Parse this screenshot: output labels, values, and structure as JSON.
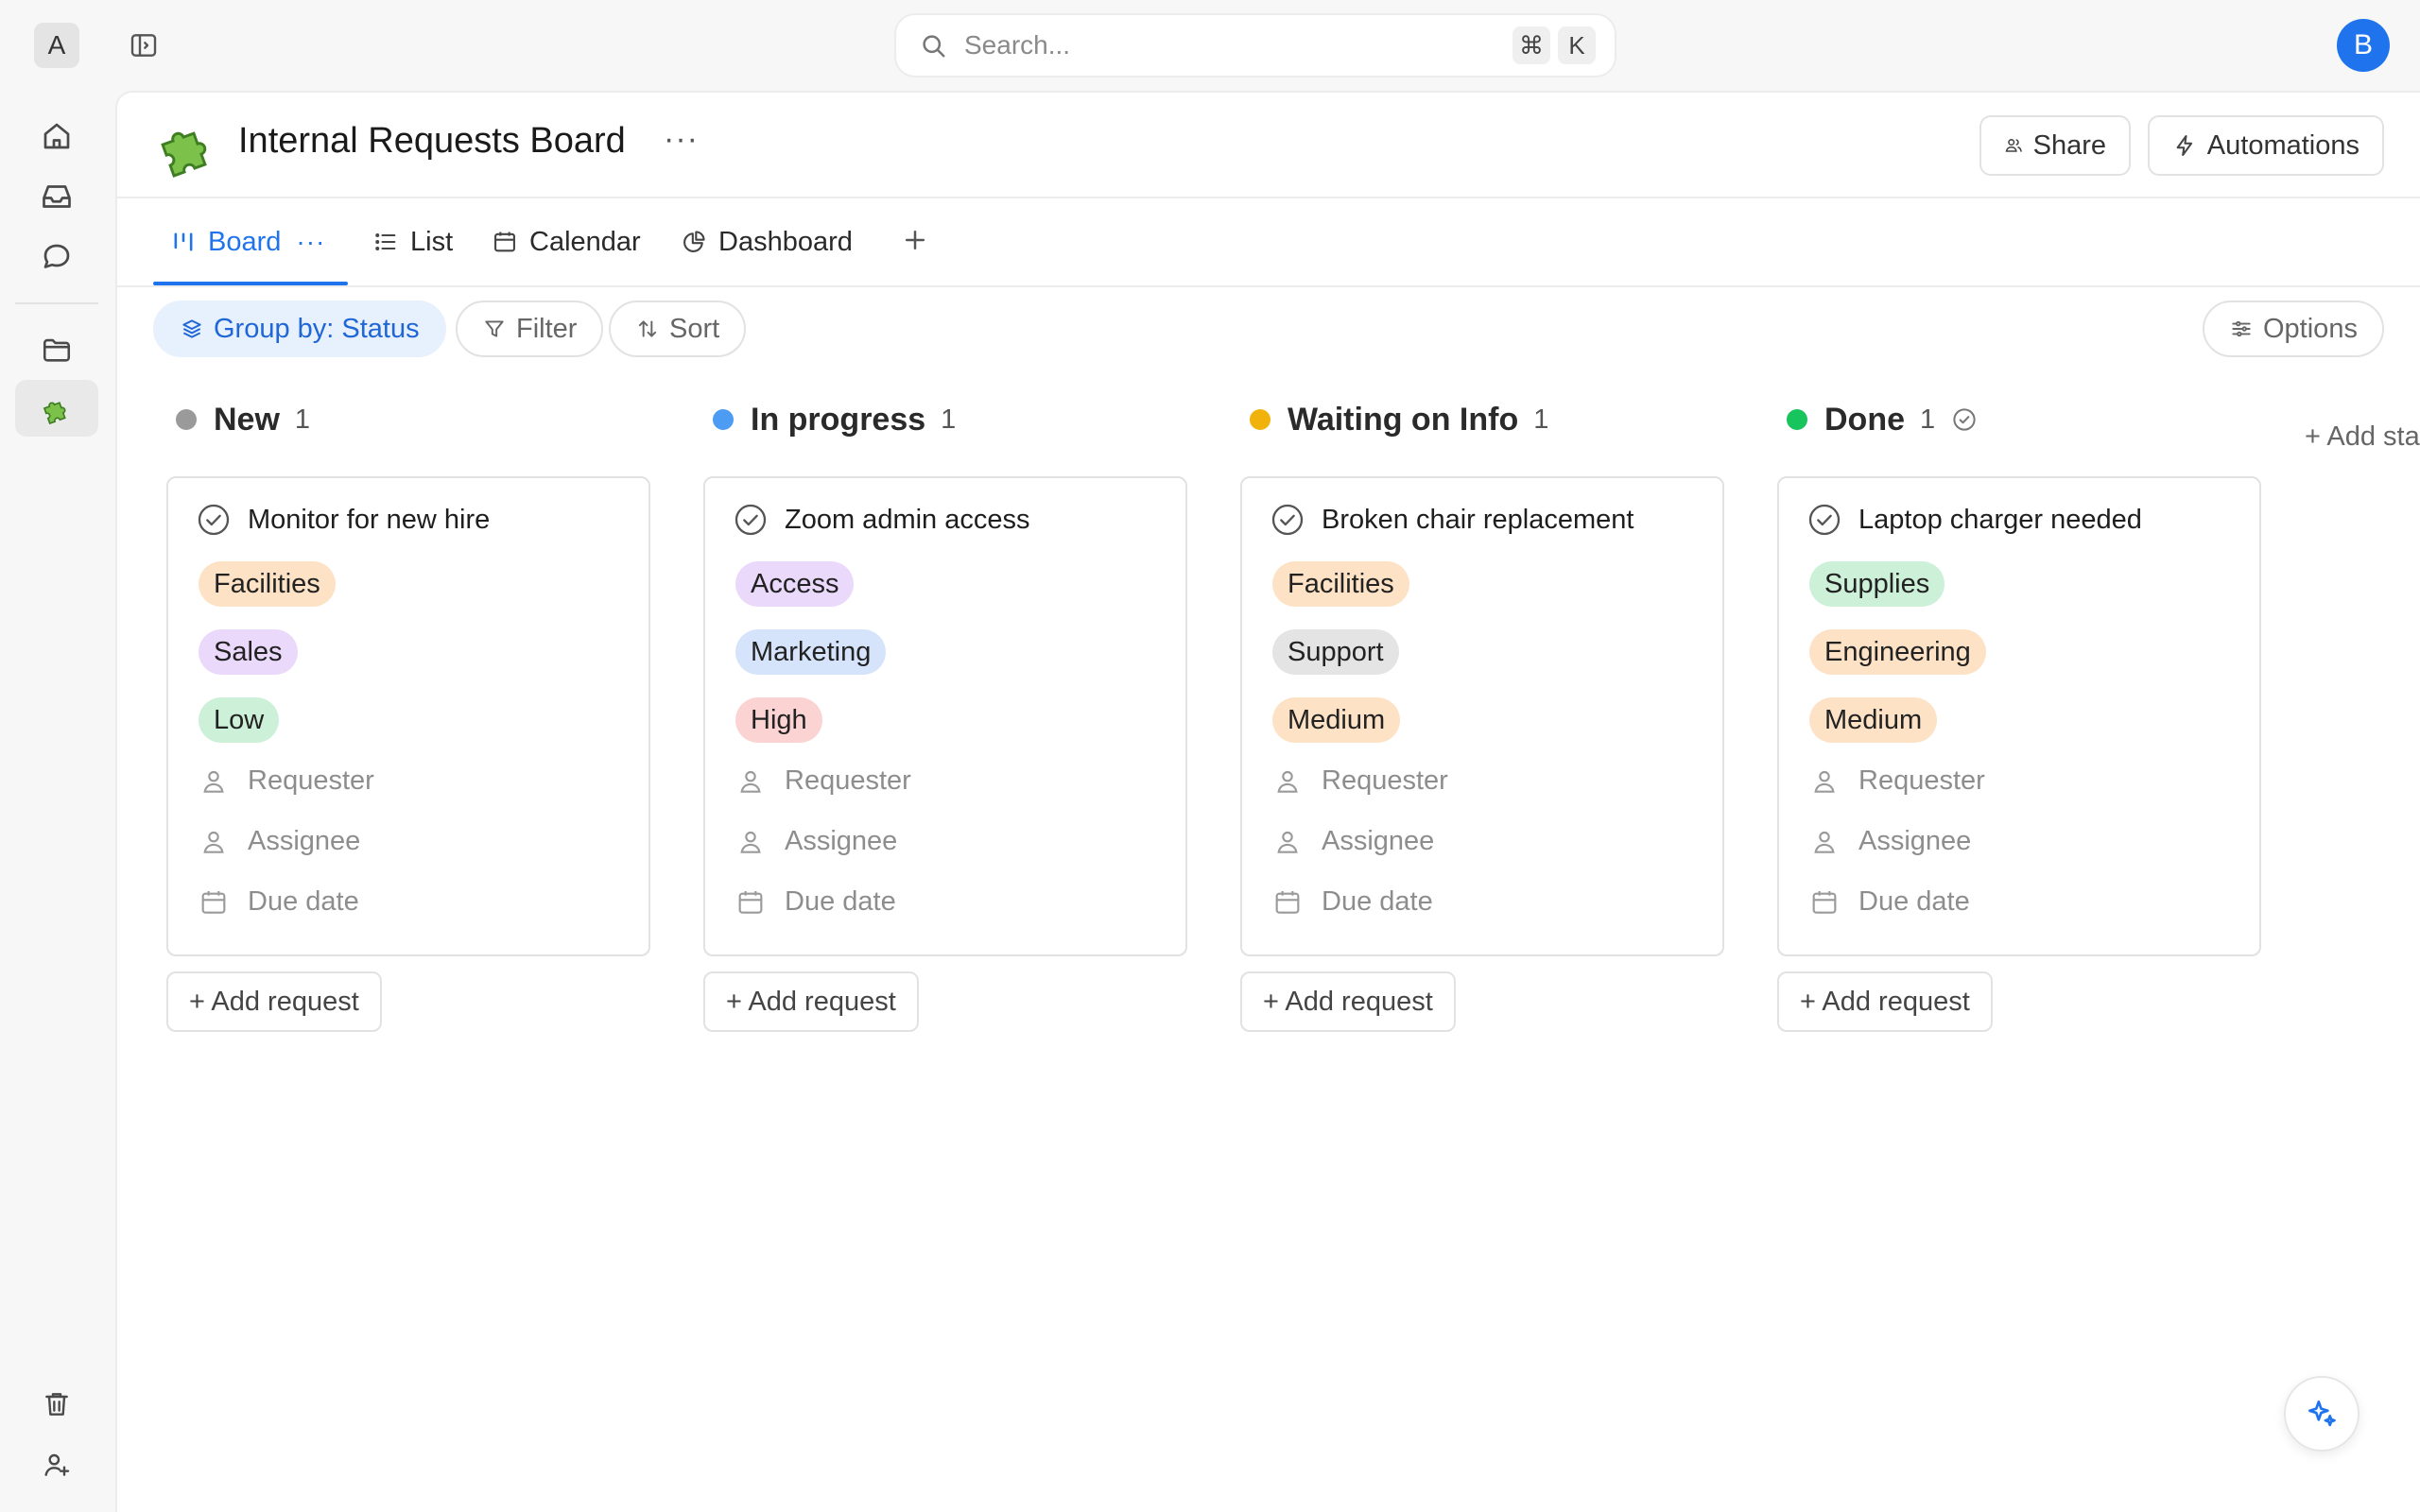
{
  "app": {
    "workspace_initial": "A",
    "user_initial": "B",
    "accent_color": "#1f74ee"
  },
  "search": {
    "placeholder": "Search...",
    "shortcut_modifier": "⌘",
    "shortcut_key": "K"
  },
  "board": {
    "title": "Internal Requests Board",
    "icon": "puzzle-piece-icon",
    "more": "···",
    "share_label": "Share",
    "automations_label": "Automations"
  },
  "tabs": [
    {
      "label": "Board",
      "icon": "board-icon",
      "active": true
    },
    {
      "label": "List",
      "icon": "list-icon",
      "active": false
    },
    {
      "label": "Calendar",
      "icon": "calendar-icon",
      "active": false
    },
    {
      "label": "Dashboard",
      "icon": "pie-chart-icon",
      "active": false
    }
  ],
  "tab_active_more": "···",
  "toolbar": {
    "group_by": "Group by: Status",
    "filter": "Filter",
    "sort": "Sort",
    "options": "Options"
  },
  "columns": [
    {
      "name": "New",
      "count": "1",
      "color": "#9a9a9a",
      "card": {
        "title": "Monitor for new hire",
        "tags": [
          {
            "label": "Facilities",
            "bg": "#fde2c6"
          },
          {
            "label": "Sales",
            "bg": "#ead9fb"
          },
          {
            "label": "Low",
            "bg": "#cdf0d8"
          }
        ]
      }
    },
    {
      "name": "In progress",
      "count": "1",
      "color": "#4b9cf2",
      "card": {
        "title": "Zoom admin access",
        "tags": [
          {
            "label": "Access",
            "bg": "#ead9fb"
          },
          {
            "label": "Marketing",
            "bg": "#d6e4fb"
          },
          {
            "label": "High",
            "bg": "#fbd3d3"
          }
        ]
      }
    },
    {
      "name": "Waiting on Info",
      "count": "1",
      "color": "#f2b20c",
      "card": {
        "title": "Broken chair replacement",
        "tags": [
          {
            "label": "Facilities",
            "bg": "#fde2c6"
          },
          {
            "label": "Support",
            "bg": "#e4e4e4"
          },
          {
            "label": "Medium",
            "bg": "#fde2c6"
          }
        ]
      }
    },
    {
      "name": "Done",
      "count": "1",
      "color": "#18c45c",
      "card": {
        "title": "Laptop charger needed",
        "tags": [
          {
            "label": "Supplies",
            "bg": "#cdf0d8"
          },
          {
            "label": "Engineering",
            "bg": "#fde2c6"
          },
          {
            "label": "Medium",
            "bg": "#fde2c6"
          }
        ]
      }
    }
  ],
  "card_fields": {
    "requester": "Requester",
    "assignee": "Assignee",
    "due_date": "Due date"
  },
  "add_request_label": "+ Add request",
  "add_status_label": "+ Add sta"
}
